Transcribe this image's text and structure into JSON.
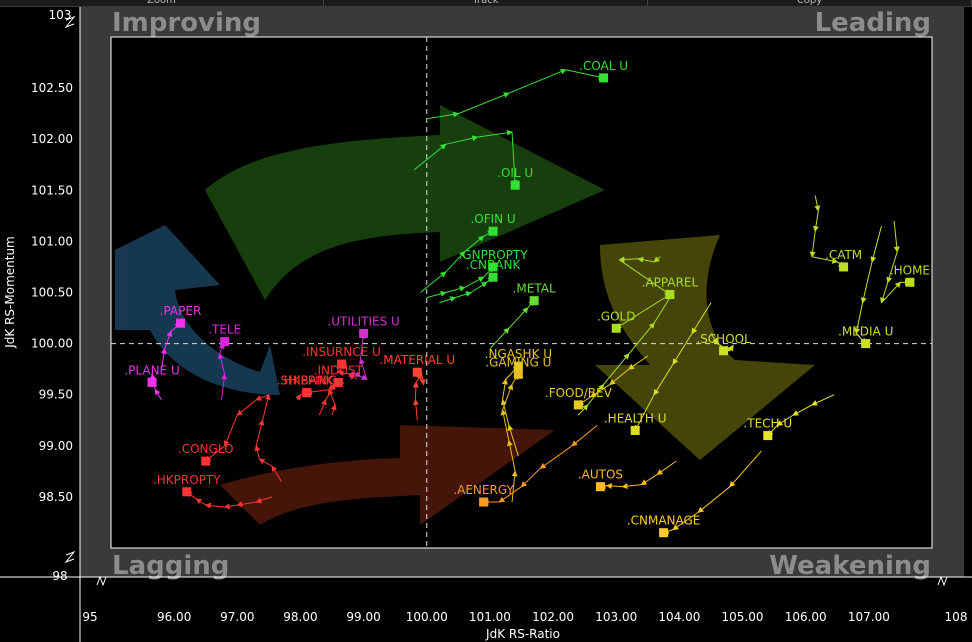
{
  "toolbar": {
    "buttons": [
      "Zoom",
      "Track",
      "Copy"
    ]
  },
  "chart_data": {
    "type": "scatter",
    "title": "",
    "xlabel": "JdK RS-Ratio",
    "ylabel": "JdK RS-Momentum",
    "xlim": [
      95,
      108
    ],
    "ylim": [
      98,
      103
    ],
    "x_ticks": [
      96,
      97,
      98,
      99,
      100,
      101,
      102,
      103,
      104,
      105,
      106,
      107
    ],
    "y_ticks": [
      98.5,
      99,
      99.5,
      100,
      100.5,
      101,
      101.5,
      102,
      102.5
    ],
    "x_edge_labels": [
      "95",
      "108"
    ],
    "y_edge_labels": [
      "98",
      "103"
    ],
    "center": [
      100,
      100
    ],
    "quadrants": {
      "top_left": "Improving",
      "top_right": "Leading",
      "bottom_left": "Lagging",
      "bottom_right": "Weakening"
    },
    "quadrant_colors": {
      "improving": "#2d6fa0",
      "leading": "#2e7d1a",
      "weakening": "#8a8a12",
      "lagging": "#8a2a14"
    },
    "series": [
      {
        "name": ".COAL U",
        "color": "#33e033",
        "x": [
          100.0,
          100.5,
          101.3,
          102.2,
          102.8
        ],
        "y": [
          102.2,
          102.25,
          102.45,
          102.68,
          102.6
        ]
      },
      {
        "name": ".OIL U",
        "color": "#33e033",
        "x": [
          99.8,
          100.3,
          100.8,
          101.35,
          101.4
        ],
        "y": [
          101.7,
          101.95,
          102.02,
          102.07,
          101.55
        ]
      },
      {
        "name": ".OFIN U",
        "color": "#33e033",
        "x": [
          99.9,
          100.3,
          100.6,
          100.9,
          101.05
        ],
        "y": [
          100.5,
          100.7,
          100.9,
          101.05,
          101.1
        ]
      },
      {
        "name": ".GNPROPTY",
        "color": "#33e033",
        "x": [
          100.0,
          100.3,
          100.6,
          100.9,
          101.05
        ],
        "y": [
          100.45,
          100.5,
          100.55,
          100.65,
          100.75
        ]
      },
      {
        "name": ".CNBANK",
        "color": "#33e033",
        "x": [
          100.2,
          100.45,
          100.7,
          100.95,
          101.05
        ],
        "y": [
          100.4,
          100.45,
          100.5,
          100.6,
          100.65
        ]
      },
      {
        "name": ".METAL",
        "color": "#66dd33",
        "x": [
          101.0,
          101.3,
          101.6,
          101.7
        ],
        "y": [
          99.95,
          100.15,
          100.35,
          100.42
        ]
      },
      {
        "name": ".APPAREL",
        "color": "#aadd22",
        "x": [
          103.7,
          103.6,
          103.35,
          103.05,
          103.85
        ],
        "y": [
          100.85,
          100.8,
          100.83,
          100.82,
          100.48
        ]
      },
      {
        "name": ".GOLD",
        "color": "#aadd22",
        "x": [
          102.4,
          102.55,
          102.8,
          103.2,
          103.6,
          103.9,
          103.0
        ],
        "y": [
          99.3,
          99.4,
          99.6,
          99.9,
          100.2,
          100.5,
          100.15
        ]
      },
      {
        "name": ".CATM",
        "color": "#bbdd22",
        "x": [
          106.15,
          106.2,
          106.15,
          106.1,
          106.5,
          106.6
        ],
        "y": [
          101.45,
          101.3,
          101.1,
          100.85,
          100.8,
          100.75
        ]
      },
      {
        "name": ".HOME",
        "color": "#bbdd22",
        "x": [
          107.4,
          107.45,
          107.3,
          107.2,
          107.5,
          107.65
        ],
        "y": [
          101.2,
          100.9,
          100.6,
          100.4,
          100.6,
          100.6
        ]
      },
      {
        "name": ".MEDIA U",
        "color": "#cce022",
        "x": [
          107.2,
          107.05,
          106.9,
          106.8,
          106.95
        ],
        "y": [
          101.15,
          100.8,
          100.4,
          100.1,
          100.0
        ]
      },
      {
        "name": ".SCHOOL",
        "color": "#cce022",
        "x": [
          104.5,
          104.6,
          104.8,
          104.85,
          104.7
        ],
        "y": [
          100.1,
          100.0,
          99.93,
          99.98,
          99.93
        ]
      },
      {
        "name": ".HEALTH U",
        "color": "#dddd22",
        "x": [
          104.5,
          104.2,
          103.9,
          103.6,
          103.3
        ],
        "y": [
          100.4,
          100.1,
          99.8,
          99.5,
          99.15
        ]
      },
      {
        "name": ".TECH U",
        "color": "#e6e622",
        "x": [
          106.45,
          106.1,
          105.8,
          105.55,
          105.4
        ],
        "y": [
          99.5,
          99.4,
          99.3,
          99.2,
          99.1
        ]
      },
      {
        "name": ".FOOD/BEV",
        "color": "#e6cc22",
        "x": [
          103.5,
          103.2,
          102.9,
          102.6,
          102.4
        ],
        "y": [
          99.88,
          99.75,
          99.6,
          99.48,
          99.4
        ]
      },
      {
        "name": ".NGASHK U",
        "color": "#e6c822",
        "x": [
          101.45,
          101.3,
          101.2,
          101.25,
          101.45
        ],
        "y": [
          98.9,
          99.2,
          99.45,
          99.65,
          99.78
        ]
      },
      {
        "name": ".GAMING U",
        "color": "#e6c022",
        "x": [
          101.35,
          101.4,
          101.3,
          101.2,
          101.35,
          101.45
        ],
        "y": [
          98.45,
          98.75,
          99.05,
          99.35,
          99.6,
          99.7
        ]
      },
      {
        "name": ".AUTOS",
        "color": "#ffbb22",
        "x": [
          103.95,
          103.65,
          103.4,
          103.1,
          102.85,
          102.75
        ],
        "y": [
          98.85,
          98.72,
          98.62,
          98.6,
          98.61,
          98.6
        ]
      },
      {
        "name": ".AENERGY",
        "color": "#ff9922",
        "x": [
          102.7,
          102.3,
          101.8,
          101.5,
          101.15,
          100.9
        ],
        "y": [
          99.2,
          99.0,
          98.78,
          98.6,
          98.45,
          98.45
        ]
      },
      {
        "name": ".CNMANAGE",
        "color": "#ffcc22",
        "x": [
          105.3,
          104.8,
          104.3,
          103.9,
          103.75
        ],
        "y": [
          98.95,
          98.6,
          98.35,
          98.18,
          98.15
        ]
      },
      {
        "name": ".MATERIAL U",
        "color": "#ff4433",
        "x": [
          99.85,
          99.82,
          99.83,
          99.92,
          99.95,
          99.85
        ],
        "y": [
          99.25,
          99.45,
          99.62,
          99.7,
          99.6,
          99.72
        ]
      },
      {
        "name": ".UTILITIES U",
        "color": "#cc33cc",
        "x": [
          98.8,
          98.82,
          98.95,
          99.05,
          98.95,
          99.0
        ],
        "y": [
          99.65,
          99.72,
          99.68,
          99.65,
          99.85,
          100.1
        ]
      },
      {
        "name": ".INSURNCE U",
        "color": "#ff3333",
        "x": [
          98.9,
          98.78,
          98.6,
          98.7,
          98.65
        ],
        "y": [
          99.65,
          99.7,
          99.72,
          99.8,
          99.8
        ]
      },
      {
        "name": ".INDUST",
        "color": "#ff3333",
        "x": [
          98.5,
          98.55,
          98.45,
          98.6,
          98.65,
          98.6
        ],
        "y": [
          99.3,
          99.4,
          99.55,
          99.65,
          99.6,
          99.62
        ]
      },
      {
        "name": ".SHIPPING",
        "color": "#ff3333",
        "x": [
          98.3,
          98.4,
          98.55,
          98.45,
          98.1
        ],
        "y": [
          99.3,
          99.45,
          99.6,
          99.55,
          99.52
        ]
      },
      {
        "name": ".HKBANK",
        "color": "#ff3333",
        "x": [
          97.95,
          98.0,
          98.1
        ],
        "y": [
          99.45,
          99.5,
          99.52
        ]
      },
      {
        "name": ".CONGLO",
        "color": "#ff3333",
        "x": [
          97.7,
          97.55,
          97.35,
          97.3,
          97.4,
          97.5,
          97.3,
          97.0,
          96.8,
          96.5
        ],
        "y": [
          98.65,
          98.8,
          98.87,
          99.0,
          99.25,
          99.5,
          99.45,
          99.3,
          99.0,
          98.85
        ]
      },
      {
        "name": ".HKPROPTY",
        "color": "#ff3333",
        "x": [
          97.55,
          97.3,
          97.0,
          96.8,
          96.5,
          96.35,
          96.2
        ],
        "y": [
          98.5,
          98.45,
          98.42,
          98.4,
          98.42,
          98.48,
          98.55
        ]
      },
      {
        "name": ".TELE",
        "color": "#dd22dd",
        "x": [
          96.75,
          96.8,
          96.72,
          96.78,
          96.8
        ],
        "y": [
          99.45,
          99.7,
          99.9,
          100.0,
          100.02
        ]
      },
      {
        "name": ".PAPER",
        "color": "#ee33ee",
        "x": [
          95.8,
          95.85,
          95.95,
          96.1
        ],
        "y": [
          99.75,
          99.95,
          100.12,
          100.2
        ]
      },
      {
        "name": ".PLANE U",
        "color": "#ee33ee",
        "x": [
          95.8,
          95.7,
          95.65,
          95.65
        ],
        "y": [
          99.45,
          99.55,
          99.7,
          99.62
        ]
      }
    ]
  }
}
